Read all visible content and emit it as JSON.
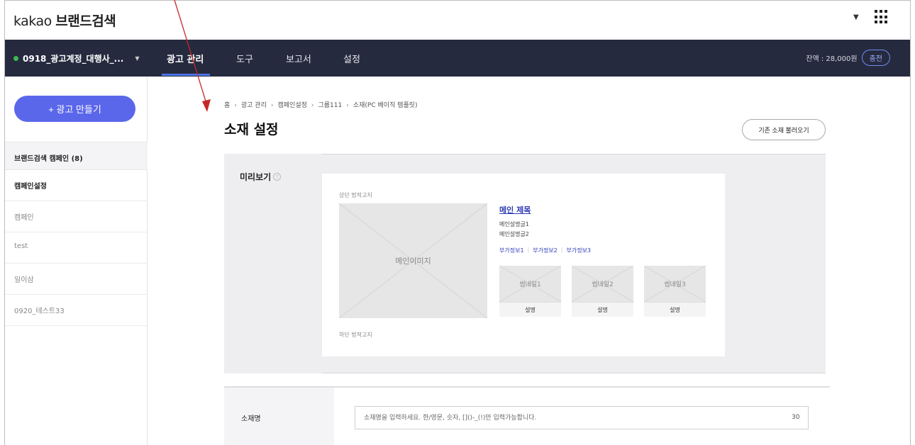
{
  "app": {
    "logo_prefix": "kakao",
    "logo_name": "브랜드검색"
  },
  "navbar": {
    "account_name": "0918_광고계정_대행사_...",
    "items": [
      "광고 관리",
      "도구",
      "보고서",
      "설정"
    ],
    "active_item": "광고 관리",
    "balance_text": "잔액 : 28,000원",
    "charge_label": "충전"
  },
  "sidebar": {
    "create_label": "+ 광고 만들기",
    "section_title": "브랜드검색 캠페인 (8)",
    "items": [
      "캠페인설정",
      "캠페인",
      "test",
      "일이삼",
      "0920_테스트33"
    ],
    "selected_item": "캠페인설정"
  },
  "breadcrumb": [
    "홈",
    "광고 관리",
    "캠페인설정",
    "그룹111",
    "소재(PC 베이직 템플릿)"
  ],
  "page": {
    "title": "소재 설정",
    "load_button": "기존 소재 불러오기"
  },
  "preview": {
    "label": "미리보기",
    "help_glyph": "?",
    "legal_top": "상단 법적고지",
    "legal_bottom": "하단 법적고지",
    "main_image": "메인이미지",
    "main_title": "메인 제목",
    "desc_lines": [
      "메인설명글1",
      "메인설명글2"
    ],
    "extra_links": [
      "부가정보1",
      "부가정보2",
      "부가정보3"
    ],
    "thumbnails": [
      {
        "label": "썸네일1",
        "desc": "설명"
      },
      {
        "label": "썸네일2",
        "desc": "설명"
      },
      {
        "label": "썸네일3",
        "desc": "설명"
      }
    ]
  },
  "form": {
    "name_label": "소재명",
    "name_placeholder": "소재명을 입력하세요. 한/영문, 숫자, []()-_(!)만 입력가능합니다.",
    "name_max": "30"
  },
  "colors": {
    "navbar_bg": "#262a3f",
    "primary_button": "#5b67ea",
    "link_blue": "#2f3bb7",
    "annotation_arrow": "#c62828"
  }
}
